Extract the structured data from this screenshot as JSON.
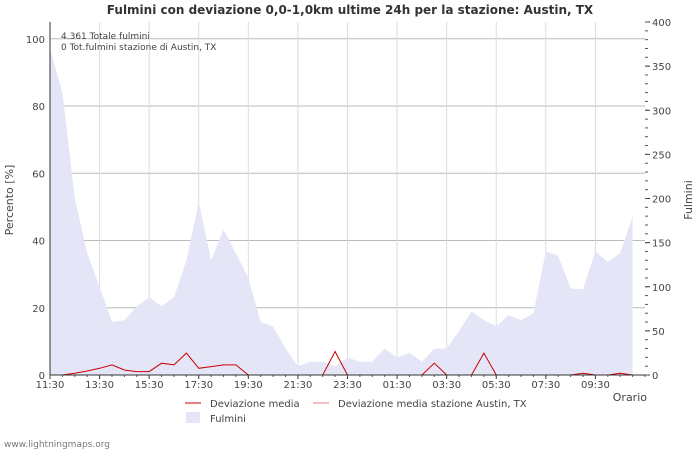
{
  "chart_data": {
    "type": "line",
    "title": "Fulmini con deviazione 0,0-1,0km ultime 24h per la stazione: Austin, TX",
    "ylabel_left": "Percento   [%]",
    "ylabel_right": "Fulmini",
    "xlabel": "Orario",
    "ylim_left": [
      0,
      105
    ],
    "ylim_right": [
      0,
      400
    ],
    "yticks_left": [
      "0",
      "20",
      "40",
      "60",
      "80",
      "100"
    ],
    "yticks_right": [
      "0",
      "50",
      "100",
      "150",
      "200",
      "250",
      "300",
      "350",
      "400"
    ],
    "x_tick_labels": [
      "11:30",
      "13:30",
      "15:30",
      "17:30",
      "19:30",
      "21:30",
      "23:30",
      "01:30",
      "03:30",
      "05:30",
      "07:30",
      "09:30"
    ],
    "x_hours": [
      0,
      2,
      4,
      6,
      8,
      10,
      12,
      14,
      16,
      18,
      20,
      22
    ],
    "grid": true,
    "info_lines": [
      "4.361 Totale fulmini",
      "0 Tot.fulmini stazione di Austin, TX"
    ],
    "x": [
      0,
      0.5,
      1,
      1.5,
      2,
      2.5,
      3,
      3.5,
      4,
      4.5,
      5,
      5.5,
      6,
      6.5,
      7,
      7.5,
      8,
      8.5,
      9,
      9.5,
      10,
      10.5,
      11,
      11.5,
      12,
      12.5,
      13,
      13.5,
      14,
      14.5,
      15,
      15.5,
      16,
      16.5,
      17,
      17.5,
      18,
      18.5,
      19,
      19.5,
      20,
      20.5,
      21,
      21.5,
      22,
      22.5,
      23,
      23.5
    ],
    "series": [
      {
        "name": "Fulmini",
        "axis": "right",
        "color": "#e5e5f8",
        "values": [
          370,
          320,
          200,
          138,
          100,
          60,
          62,
          78,
          88,
          78,
          88,
          130,
          196,
          130,
          165,
          138,
          110,
          60,
          55,
          30,
          10,
          15,
          15,
          10,
          20,
          15,
          15,
          30,
          20,
          25,
          15,
          30,
          30,
          50,
          72,
          62,
          55,
          68,
          62,
          70,
          140,
          135,
          98,
          97,
          140,
          128,
          138,
          180
        ]
      },
      {
        "name": "Deviazione media",
        "axis": "left",
        "color": "#cc0000",
        "values": [
          0,
          0,
          0.5,
          1.2,
          2,
          3,
          1.5,
          1,
          1,
          3.5,
          3,
          6.5,
          2,
          2.5,
          3,
          3,
          0,
          0,
          0,
          0,
          0,
          0,
          0,
          7,
          0,
          0,
          0,
          0,
          0,
          0,
          0,
          3.5,
          0,
          0,
          0,
          6.5,
          0,
          0,
          0,
          0,
          0,
          0,
          0,
          0.5,
          0,
          0,
          0.5,
          0
        ]
      },
      {
        "name": "Deviazione media stazione Austin, TX",
        "axis": "left",
        "color": "#f08080",
        "values": []
      }
    ]
  },
  "footer": "www.lightningmaps.org"
}
